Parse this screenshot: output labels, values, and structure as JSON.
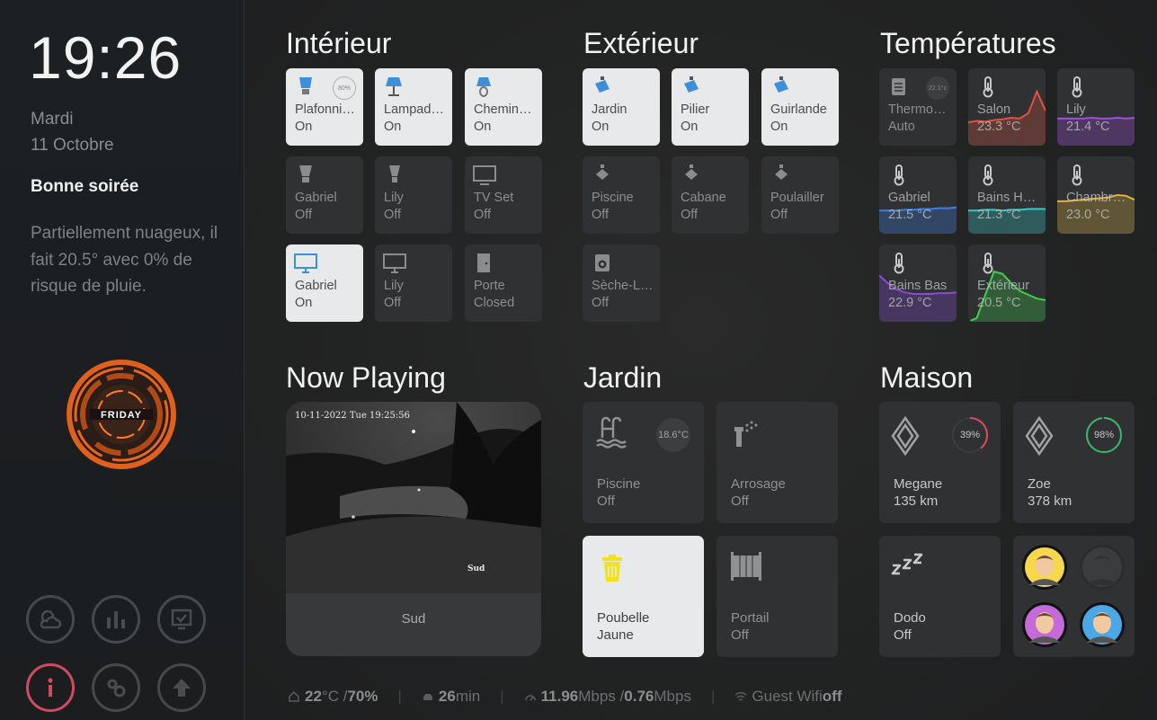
{
  "sidebar": {
    "time": "19:26",
    "day": "Mardi",
    "date": "11 Octobre",
    "greeting": "Bonne soirée",
    "weather": "Partiellement nuageux, il fait 20.5° avec 0% de risque de pluie.",
    "logo_text": "FRIDAY",
    "nav": [
      {
        "icon": "weather-icon"
      },
      {
        "icon": "chart-icon"
      },
      {
        "icon": "monitor-icon"
      },
      {
        "icon": "info-icon"
      },
      {
        "icon": "settings-icon"
      },
      {
        "icon": "upload-icon"
      }
    ]
  },
  "interieur": {
    "title": "Intérieur",
    "tiles": [
      {
        "name": "Plafonni…",
        "state": "On",
        "on": true,
        "icon": "ceiling-bulb-icon",
        "badge": "80%"
      },
      {
        "name": "Lampad…",
        "state": "On",
        "on": true,
        "icon": "floor-lamp-icon"
      },
      {
        "name": "Chemin…",
        "state": "On",
        "on": true,
        "icon": "lamp-icon"
      },
      {
        "name": "Gabriel",
        "state": "Off",
        "on": false,
        "icon": "bulb-icon"
      },
      {
        "name": "Lily",
        "state": "Off",
        "on": false,
        "icon": "bulb-icon"
      },
      {
        "name": "TV Set",
        "state": "Off",
        "on": false,
        "icon": "tv-icon"
      },
      {
        "name": "Gabriel",
        "state": "On",
        "on": true,
        "icon": "monitor-icon"
      },
      {
        "name": "Lily",
        "state": "Off",
        "on": false,
        "icon": "monitor-icon"
      },
      {
        "name": "Porte",
        "state": "Closed",
        "on": false,
        "icon": "door-icon"
      }
    ]
  },
  "exterieur": {
    "title": "Extérieur",
    "tiles": [
      {
        "name": "Jardin",
        "state": "On",
        "on": true,
        "icon": "outdoor-lamp-icon"
      },
      {
        "name": "Pilier",
        "state": "On",
        "on": true,
        "icon": "outdoor-lamp-icon"
      },
      {
        "name": "Guirlande",
        "state": "On",
        "on": true,
        "icon": "outdoor-lamp-icon"
      },
      {
        "name": "Piscine",
        "state": "Off",
        "on": false,
        "icon": "outdoor-lamp-icon"
      },
      {
        "name": "Cabane",
        "state": "Off",
        "on": false,
        "icon": "outdoor-lamp-icon"
      },
      {
        "name": "Poulailler",
        "state": "Off",
        "on": false,
        "icon": "outdoor-lamp-icon"
      },
      {
        "name": "Sèche-L…",
        "state": "Off",
        "on": false,
        "icon": "dryer-icon"
      }
    ]
  },
  "temperatures": {
    "title": "Températures",
    "tiles": [
      {
        "name": "Thermo…",
        "state": "Auto",
        "badge": "22.1°c",
        "icon": "thermostat-icon"
      },
      {
        "name": "Salon",
        "state": "23.3 °C",
        "color": "#e0533f",
        "icon": "thermometer-icon",
        "trend": [
          0.3,
          0.32,
          0.31,
          0.33,
          0.34,
          0.36,
          0.35,
          0.42,
          0.7,
          0.45
        ]
      },
      {
        "name": "Lily",
        "state": "21.4 °C",
        "color": "#a14de0",
        "icon": "thermometer-icon",
        "trend": [
          0.35,
          0.35,
          0.35,
          0.35,
          0.36,
          0.35,
          0.35,
          0.36,
          0.35,
          0.36
        ]
      },
      {
        "name": "Gabriel",
        "state": "21.5 °C",
        "color": "#3d7ee8",
        "icon": "thermometer-icon",
        "trend": [
          0.3,
          0.3,
          0.3,
          0.31,
          0.31,
          0.32,
          0.32,
          0.33,
          0.33,
          0.34
        ]
      },
      {
        "name": "Bains H…",
        "state": "21.3 °C",
        "color": "#37c9c9",
        "icon": "thermometer-icon",
        "trend": [
          0.3,
          0.3,
          0.31,
          0.31,
          0.3,
          0.31,
          0.31,
          0.32,
          0.32,
          0.32
        ]
      },
      {
        "name": "Chambr…",
        "state": "23.0 °C",
        "color": "#e4b43a",
        "icon": "thermometer-icon",
        "trend": [
          0.42,
          0.42,
          0.43,
          0.44,
          0.45,
          0.46,
          0.47,
          0.5,
          0.49,
          0.44
        ]
      },
      {
        "name": "Bains Bas",
        "state": "22.9 °C",
        "color": "#8a49d6",
        "icon": "thermometer-icon",
        "trend": [
          0.6,
          0.5,
          0.42,
          0.38,
          0.36,
          0.36,
          0.36,
          0.37,
          0.37,
          0.38
        ]
      },
      {
        "name": "Extérieur",
        "state": "20.5 °C",
        "color": "#3fcf4a",
        "icon": "thermometer-icon",
        "trend": [
          0.0,
          0.05,
          0.35,
          0.65,
          0.62,
          0.5,
          0.4,
          0.35,
          0.3,
          0.28
        ]
      }
    ]
  },
  "now_playing": {
    "title": "Now Playing",
    "camera_timestamp": "10-11-2022 Tue 19:25:56",
    "camera_caption": "Sud",
    "label": "Sud"
  },
  "jardin": {
    "title": "Jardin",
    "tiles": [
      {
        "name": "Piscine",
        "state": "Off",
        "badge": "18.6°C",
        "icon": "pool-icon"
      },
      {
        "name": "Arrosage",
        "state": "Off",
        "icon": "sprinkler-icon"
      },
      {
        "name": "Poubelle",
        "state": "Jaune",
        "on": true,
        "icon": "trash-can-icon"
      },
      {
        "name": "Portail",
        "state": "Off",
        "icon": "gate-icon"
      }
    ]
  },
  "maison": {
    "title": "Maison",
    "cars": [
      {
        "name": "Megane",
        "state": "135 km",
        "battery": "39%",
        "battery_value": 0.39,
        "color": "#e04a5c",
        "icon": "renault-logo-icon"
      },
      {
        "name": "Zoe",
        "state": "378 km",
        "battery": "98%",
        "battery_value": 0.98,
        "color": "#3fb86a",
        "icon": "renault-logo-icon"
      }
    ],
    "dodo": {
      "name": "Dodo",
      "state": "Off",
      "icon": "sleep-icon"
    },
    "people": [
      {
        "name": "person-1",
        "color": "#f5d94a",
        "present": true
      },
      {
        "name": "person-2",
        "color": "#3a3c3e",
        "present": false
      },
      {
        "name": "person-3",
        "color": "#c56ad9",
        "present": true
      },
      {
        "name": "person-4",
        "color": "#4aa7e8",
        "present": true
      }
    ]
  },
  "statusbar": {
    "home_temp": "22",
    "home_temp_unit": "°C / ",
    "home_hum": "70%",
    "commute": "26",
    "commute_unit": " min",
    "down": "11.96",
    "down_unit": " Mbps / ",
    "up": "0.76",
    "up_unit": " Mbps",
    "wifi_label": "Guest Wifi ",
    "wifi_state": "off"
  },
  "colors": {
    "accent_blue": "#3d8fd9",
    "accent_yellow": "#f2e21a",
    "info_red": "#cf4b62"
  }
}
